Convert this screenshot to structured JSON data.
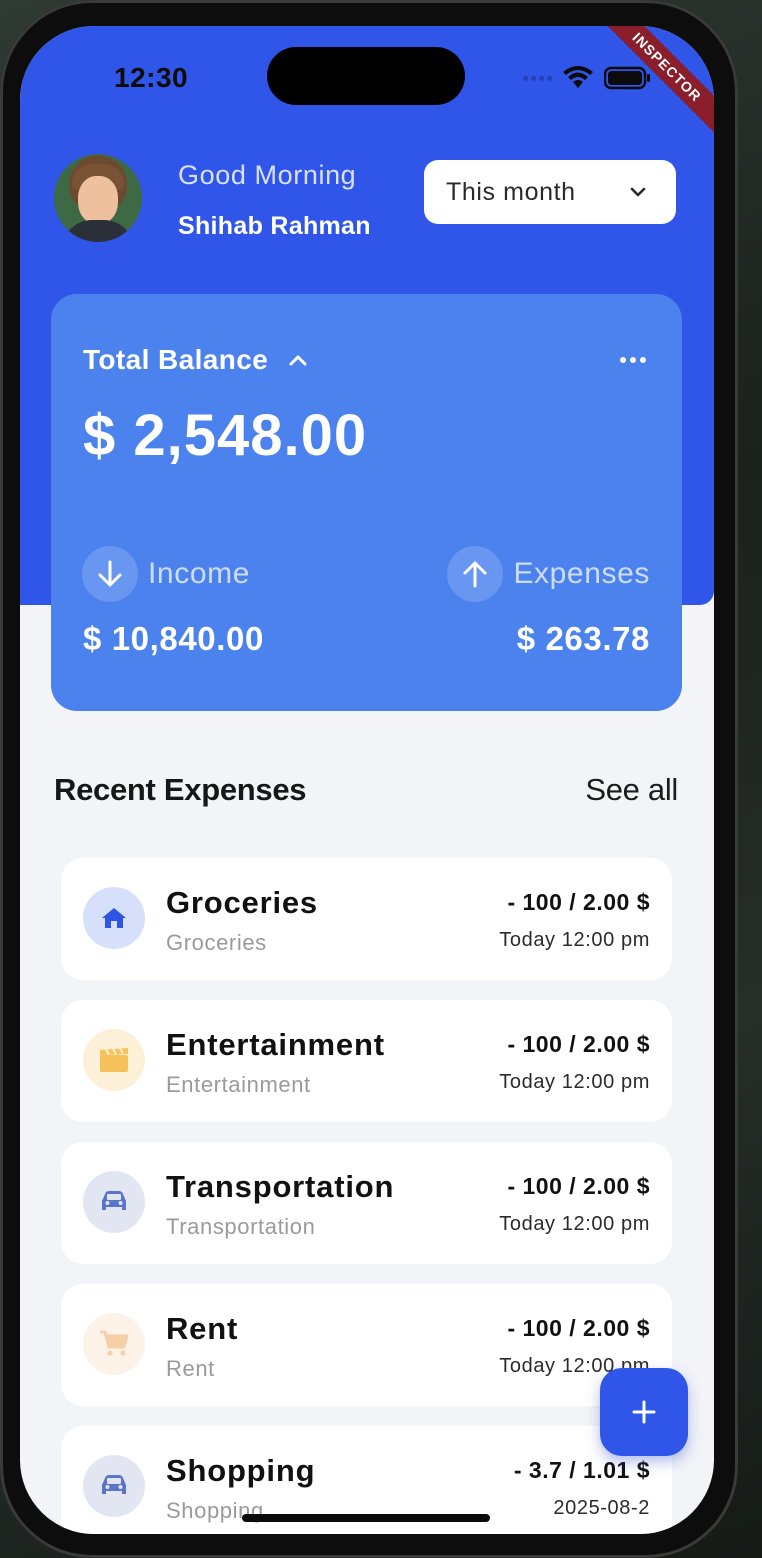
{
  "status_bar": {
    "time": "12:30"
  },
  "debug_banner": "INSPECTOR",
  "header": {
    "greeting": "Good Morning",
    "user_name": "Shihab Rahman",
    "period_selected": "This month"
  },
  "balance_card": {
    "title": "Total Balance",
    "amount": "$ 2,548.00",
    "income_label": "Income",
    "income_amount": "$ 10,840.00",
    "expenses_label": "Expenses",
    "expenses_amount": "$ 263.78"
  },
  "recent": {
    "title": "Recent Expenses",
    "see_all": "See all",
    "items": [
      {
        "name": "Groceries",
        "category": "Groceries",
        "amount": "- 100  / 2.00 $",
        "date": "Today 12:00 pm",
        "icon": "home-icon",
        "color": "#2f55e4",
        "bg": "#d7e0fb"
      },
      {
        "name": "Entertainment",
        "category": "Entertainment",
        "amount": "- 100  / 2.00 $",
        "date": "Today 12:00 pm",
        "icon": "clapperboard-icon",
        "color": "#f6c15a",
        "bg": "#fdf0d8"
      },
      {
        "name": "Transportation",
        "category": "Transportation",
        "amount": "- 100  / 2.00 $",
        "date": "Today 12:00 pm",
        "icon": "car-icon",
        "color": "#5a74c9",
        "bg": "#e2e6f3"
      },
      {
        "name": "Rent",
        "category": "Rent",
        "amount": "- 100  / 2.00 $",
        "date": "Today 12:00 pm",
        "icon": "cart-icon",
        "color": "#f6cfa8",
        "bg": "#fdf2e8"
      },
      {
        "name": "Shopping",
        "category": "Shopping",
        "amount": "- 3.7  / 1.01 $",
        "date": "2025-08-2",
        "icon": "car-icon",
        "color": "#5a74c9",
        "bg": "#e2e6f3"
      }
    ]
  },
  "colors": {
    "primary": "#3056e9",
    "card": "#4c82ee",
    "background": "#f3f4f8"
  }
}
